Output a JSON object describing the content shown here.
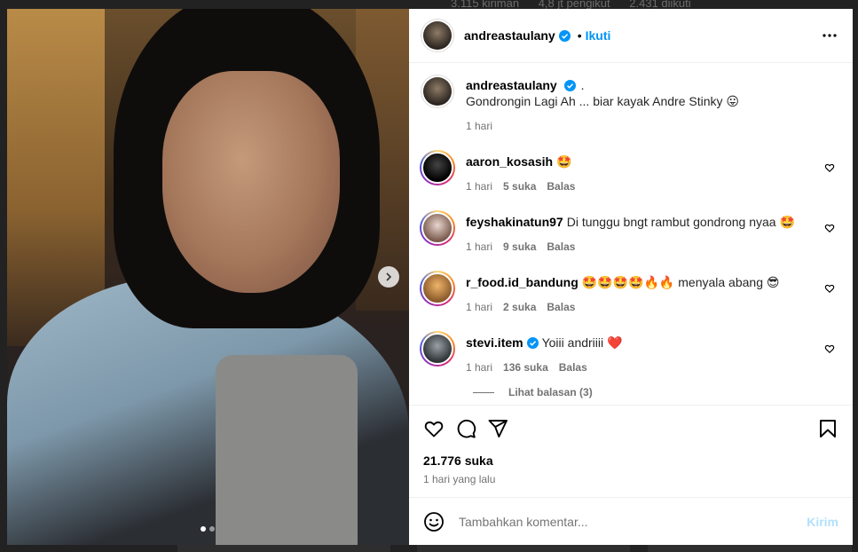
{
  "background": {
    "stats": [
      "3.115 kiriman",
      "4,8 jt pengikut",
      "2.431 diikuti"
    ]
  },
  "post": {
    "author": "andreastaulany",
    "follow_label": "Ikuti",
    "bullet": "•",
    "caption_dot": ".",
    "caption": "Gondrongin Lagi Ah ... biar kayak Andre Stinky 😛",
    "caption_time": "1 hari",
    "slide_index": 1,
    "slide_count": 2,
    "likes": "21.776 suka",
    "time_ago": "1 hari yang lalu"
  },
  "comments": [
    {
      "user": "aaron_kosasih",
      "text": "🤩",
      "time": "1 hari",
      "likes": "5 suka",
      "reply": "Balas",
      "verified": false
    },
    {
      "user": "feyshakinatun97",
      "text": "Di tunggu bngt rambut gondrong nyaa 🤩",
      "time": "1 hari",
      "likes": "9 suka",
      "reply": "Balas",
      "verified": false
    },
    {
      "user": "r_food.id_bandung",
      "text": "🤩🤩🤩🤩🔥🔥 menyala abang 😎",
      "time": "1 hari",
      "likes": "2 suka",
      "reply": "Balas",
      "verified": false
    },
    {
      "user": "stevi.item",
      "text": "Yoiii andriiii ❤️",
      "time": "1 hari",
      "likes": "136 suka",
      "reply": "Balas",
      "verified": true
    }
  ],
  "view_replies": "Lihat balasan (3)",
  "composer": {
    "placeholder": "Tambahkan komentar...",
    "post_label": "Kirim"
  },
  "icons": {
    "verified": "verified-badge-icon",
    "more": "more-options-icon",
    "like": "heart-icon",
    "comment": "comment-icon",
    "share": "share-icon",
    "save": "bookmark-icon",
    "emoji": "emoji-icon",
    "next": "chevron-right-icon"
  },
  "colors": {
    "accent": "#0095f6",
    "verified": "#0095f6",
    "post_disabled": "#b2dffc"
  }
}
